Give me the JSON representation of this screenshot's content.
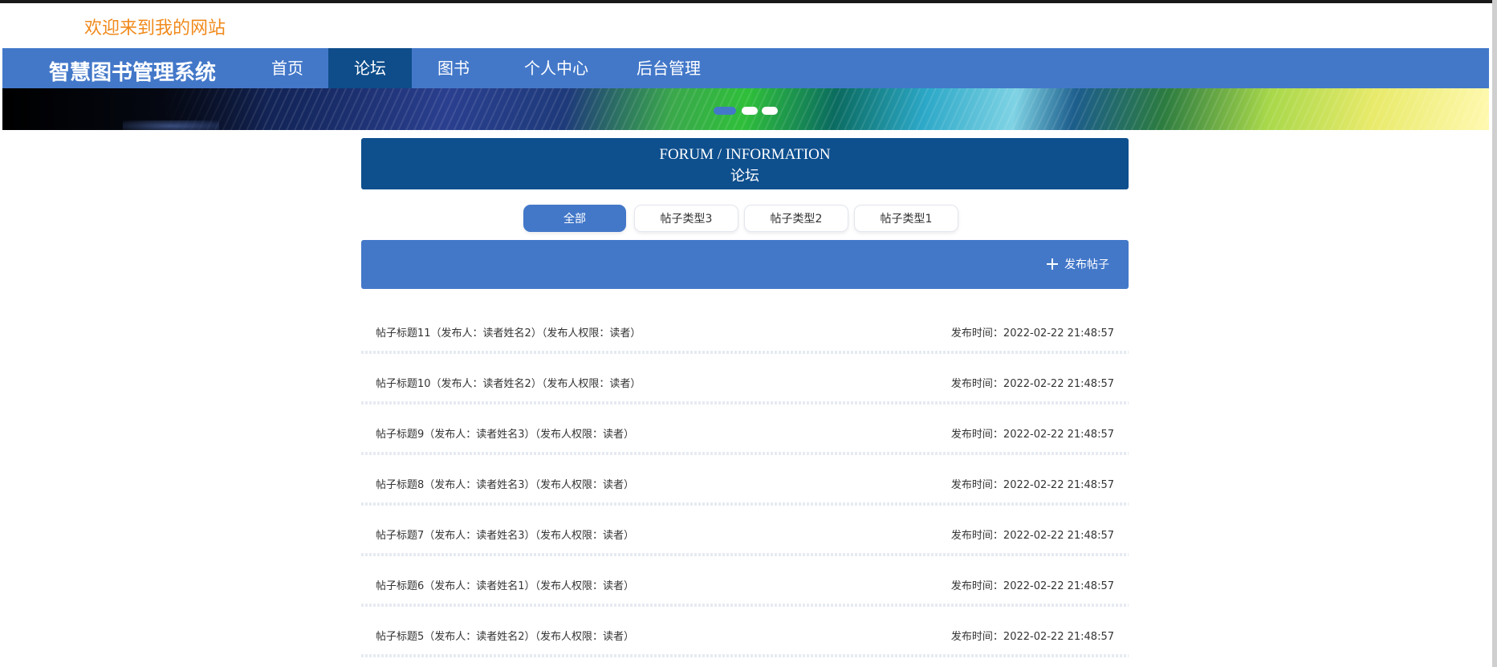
{
  "site": {
    "welcome": "欢迎来到我的网站"
  },
  "nav": {
    "brand": "智慧图书管理系统",
    "items": [
      {
        "label": "首页"
      },
      {
        "label": "论坛"
      },
      {
        "label": "图书"
      },
      {
        "label": "个人中心"
      },
      {
        "label": "后台管理"
      }
    ],
    "active": "论坛"
  },
  "banner": {
    "slide_count": 3,
    "active_slide": 1
  },
  "section": {
    "title_en": "FORUM / INFORMATION",
    "title_cn": "论坛"
  },
  "tabs": [
    {
      "label": "全部"
    },
    {
      "label": "帖子类型3"
    },
    {
      "label": "帖子类型2"
    },
    {
      "label": "帖子类型1"
    }
  ],
  "active_tab": "全部",
  "actions": {
    "post_label": "发布帖子"
  },
  "posts": [
    {
      "title": "帖子标题11（发布人：读者姓名2）（发布人权限：读者）",
      "time": "发布时间：2022-02-22 21:48:57"
    },
    {
      "title": "帖子标题10（发布人：读者姓名2）（发布人权限：读者）",
      "time": "发布时间：2022-02-22 21:48:57"
    },
    {
      "title": "帖子标题9（发布人：读者姓名3）（发布人权限：读者）",
      "time": "发布时间：2022-02-22 21:48:57"
    },
    {
      "title": "帖子标题8（发布人：读者姓名3）（发布人权限：读者）",
      "time": "发布时间：2022-02-22 21:48:57"
    },
    {
      "title": "帖子标题7（发布人：读者姓名3）（发布人权限：读者）",
      "time": "发布时间：2022-02-22 21:48:57"
    },
    {
      "title": "帖子标题6（发布人：读者姓名1）（发布人权限：读者）",
      "time": "发布时间：2022-02-22 21:48:57"
    },
    {
      "title": "帖子标题5（发布人：读者姓名2）（发布人权限：读者）",
      "time": "发布时间：2022-02-22 21:48:57"
    }
  ],
  "colors": {
    "primary": "#4378c9",
    "primary_dark": "#0e4f8e",
    "welcome": "#f08a1c"
  },
  "overlay": {
    "text": ""
  }
}
